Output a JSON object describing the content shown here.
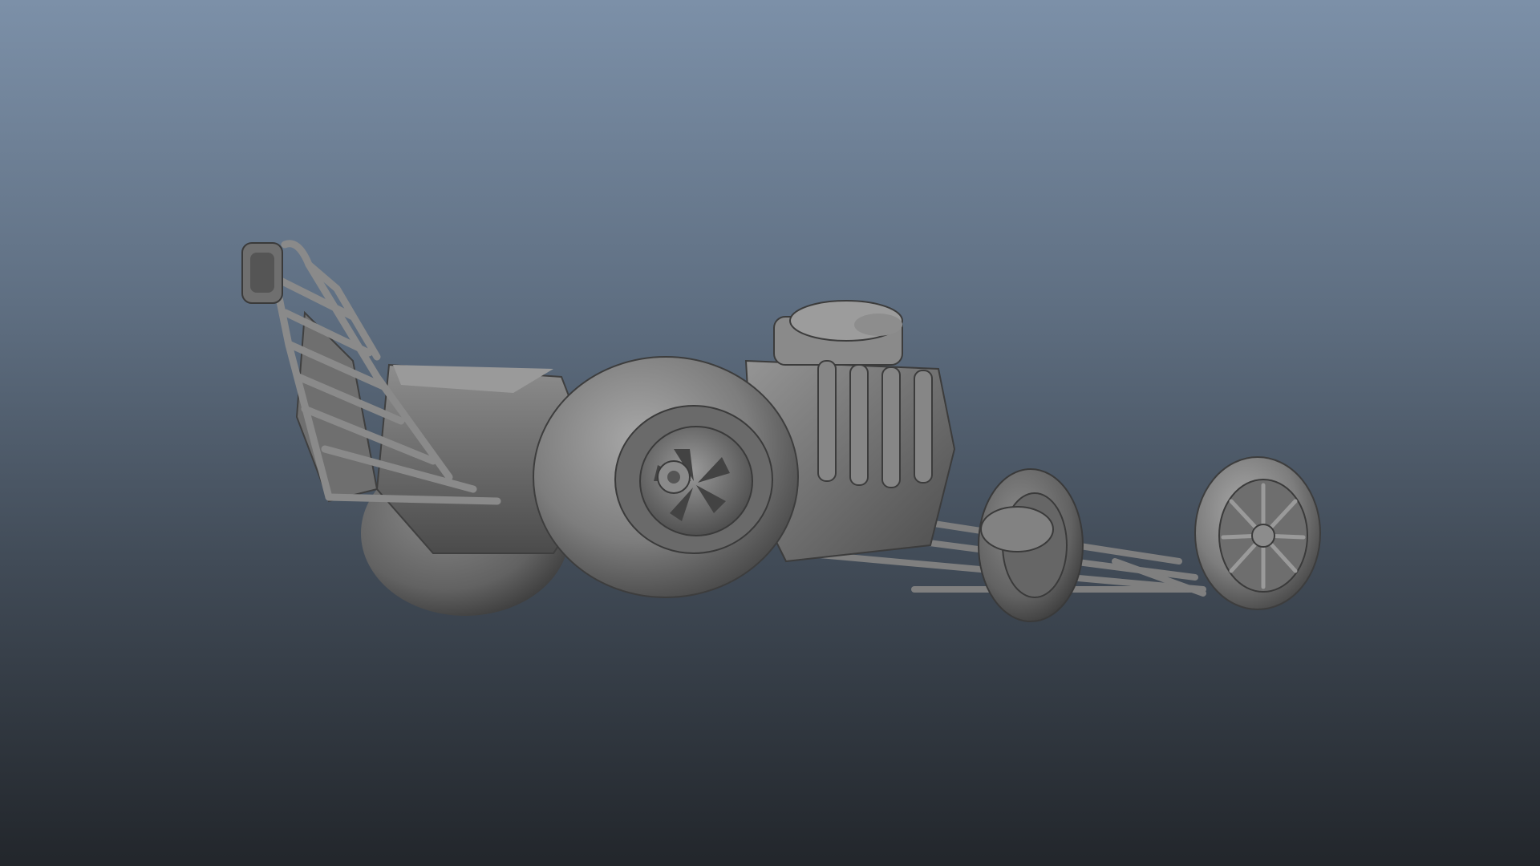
{
  "viewport": {
    "background_top": "#7c90a8",
    "background_bottom": "#22262b",
    "model_shade_light": "#a7a7a7",
    "model_shade_mid": "#7e7e7e",
    "model_shade_dark": "#4a4a4a"
  },
  "model": {
    "icon": "dragster-3d-model"
  }
}
